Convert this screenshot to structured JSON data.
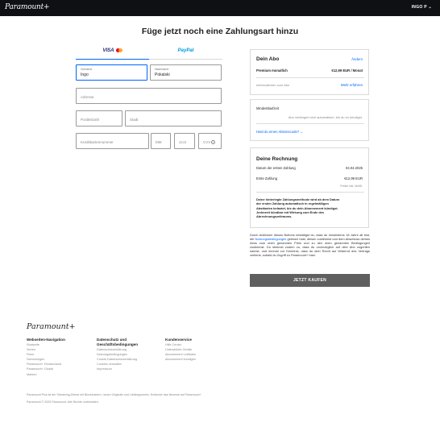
{
  "header": {
    "logo": "Paramount+",
    "user_menu": "INGO P ⌄"
  },
  "page": {
    "title": "Füge jetzt noch eine Zahlungsart hinzu"
  },
  "payment_tabs": {
    "visa": "VISA",
    "paypal": "PayPal"
  },
  "form": {
    "firstname_label": "Vorname",
    "firstname_value": "Ingo",
    "lastname_label": "Nachname",
    "lastname_value": "Pokalski",
    "address_placeholder": "Adresse",
    "zip_placeholder": "Postleitzahl",
    "city_placeholder": "Stadt",
    "card_placeholder": "Kreditkartennummer",
    "month_placeholder": "MM",
    "year_placeholder": "JJJJ",
    "cvv_placeholder": "CVV",
    "cvv_icon": "info-icon"
  },
  "subscription": {
    "title": "Dein Abo",
    "change_link": "Ändern",
    "plan": "Premium monatlich",
    "price": "€12,99 EUR / Monat",
    "info": "Informationen zum Abo",
    "more_link": "Mehr erfahren"
  },
  "promo": {
    "label": "Mindestlaufzeit",
    "text": "Abo verlängert sich automatisch, bis du es kündigst.",
    "code_link": "Hast du einen Aktionscode? ⌄"
  },
  "invoice": {
    "title": "Deine Rechnung",
    "first_date_label": "Datum der ersten Zahlung",
    "first_date": "04.04.2025",
    "first_payment_label": "Erste Zahlung",
    "first_payment": "€12,99 EUR",
    "tax_note": "Preise inkl. MwSt.",
    "notice": "Deine hinterlegte Zahlungsmethode wird ab dem Datum der ersten Zahlung automatisch in regelmäßigen Abständen belastet, bis du dein Abonnement kündigst. Jederzeit kündbar mit Wirkung zum Ende des Abrechnungszeitraums."
  },
  "legal": {
    "part1": "Durch Anklicken dieses Buttons bestätigst du, dass du mindestens 18 Jahre alt bist, die ",
    "terms_link": "Nutzungsbedingungen",
    "part2": " gelesen hast, diesen zustimmst und dem Abschluss deines Abos zum oben genannten Preis und zu den oben genannten Bedingungen zustimmst. Du stimmst zudem zu, dass du unverzüglich auf dein Abo zugreifen kannst, und nimmst zur Kenntnis, dass du dein Recht auf Widerruf des Vertrags verlierst, sobald du Zugriff zu Paramount+ hast."
  },
  "buy_button": "JETZT KAUFEN",
  "footer": {
    "logo": "Paramount+",
    "col1": {
      "title": "Webseiten-Navigation",
      "items": [
        "Startseite",
        "Serien",
        "Filme",
        "Sammlungen",
        "Paramount+ Deutschland",
        "Paramount+ Global",
        "Marken"
      ]
    },
    "col2": {
      "title": "Datenschutz und Geschäftsbedingungen",
      "items": [
        "Datenschutzerklärung",
        "Nutzungsbedingungen",
        "Cookie-Datenschutzerklärung",
        "Cookies verwalten",
        "Impressum"
      ]
    },
    "col3": {
      "title": "Kundenservice",
      "items": [
        "Hilfe Center",
        "Unterstützte Geräte",
        "Abonnement Leitfaden",
        "Abonnement kündigen"
      ]
    },
    "note1": "Paramount Plus ist der Streaming-Dienst mit Blockbustern, neuen Originals und Lieblingsserien. Entdecke das Neueste auf Paramount+",
    "note2": "Paramount © 2025 Paramount. Alle Rechte vorbehalten."
  }
}
